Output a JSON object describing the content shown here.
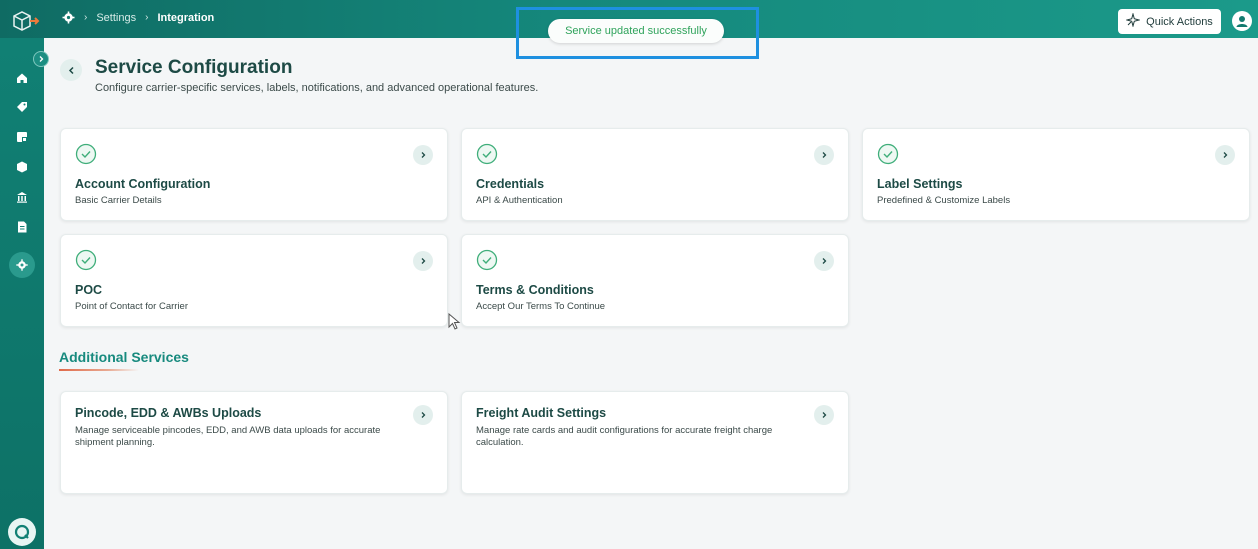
{
  "breadcrumb": {
    "home_icon": "gear-icon",
    "items": [
      "Settings",
      "Integration"
    ]
  },
  "toast": {
    "message": "Service updated successfully",
    "color": "#2fa35b"
  },
  "header": {
    "quick_actions_label": "Quick Actions"
  },
  "sidebar": {
    "icons": [
      "home-icon",
      "tag-icon",
      "shipment-icon",
      "box-icon",
      "bank-icon",
      "document-icon",
      "settings-icon"
    ],
    "active": "settings-icon"
  },
  "page": {
    "title": "Service Configuration",
    "subtitle": "Configure carrier-specific services, labels, notifications, and advanced operational features."
  },
  "cards": [
    {
      "title": "Account Configuration",
      "subtitle": "Basic Carrier Details"
    },
    {
      "title": "Credentials",
      "subtitle": "API & Authentication"
    },
    {
      "title": "Label Settings",
      "subtitle": "Predefined & Customize Labels"
    },
    {
      "title": "POC",
      "subtitle": "Point of Contact for Carrier"
    },
    {
      "title": "Terms & Conditions",
      "subtitle": "Accept Our Terms To Continue"
    }
  ],
  "additional": {
    "title": "Additional Services",
    "cards": [
      {
        "title": "Pincode, EDD & AWBs Uploads",
        "subtitle": "Manage serviceable pincodes, EDD, and AWB data uploads for accurate shipment planning."
      },
      {
        "title": "Freight Audit Settings",
        "subtitle": "Manage rate cards and audit configurations for accurate freight charge calculation."
      }
    ]
  },
  "colors": {
    "brand": "#0f6b63",
    "accent": "#178a7e",
    "check": "#3fae7a"
  }
}
